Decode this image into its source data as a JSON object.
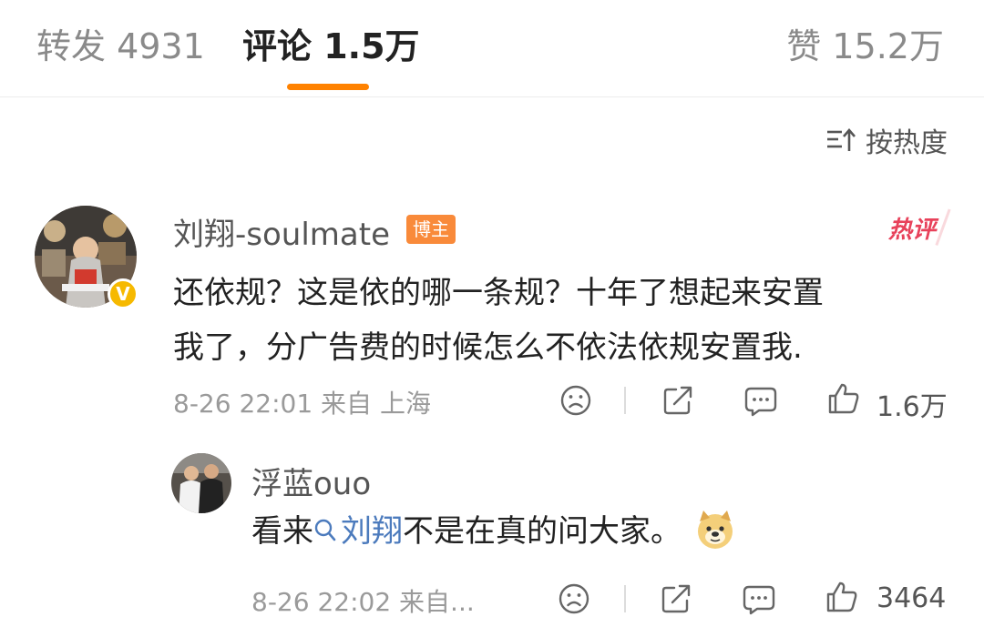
{
  "tabs": [
    {
      "label": "转发 4931"
    },
    {
      "label": "评论 1.5万"
    },
    {
      "label": "赞 15.2万"
    }
  ],
  "sort": {
    "label": "按热度",
    "icon": "sort-icon"
  },
  "comments": [
    {
      "username": "刘翔-soulmate",
      "badge": "博主",
      "verified_mark": "V",
      "hot_tag": "热评",
      "line1": "还依规？这是依的哪一条规？十年了想起来安置",
      "line2": "我了，分广告费的时候怎么不依法依规安置我.",
      "meta": "8-26 22:01 来自 上海",
      "likes": "1.6万"
    },
    {
      "username": "浮蓝ouo",
      "text_before": "看来",
      "mention": "刘翔",
      "text_after": "不是在真的问大家。",
      "meta": "8-26 22:02 来自...",
      "likes": "3464"
    }
  ],
  "icons": {
    "react": "sad-face-icon",
    "share": "share-icon",
    "reply": "comment-icon",
    "like": "thumbs-up-icon"
  },
  "colors": {
    "accent": "#ff8200",
    "mention": "#4c7bbd",
    "hot": "#e8425b",
    "owner_badge": "#f98a3a"
  }
}
